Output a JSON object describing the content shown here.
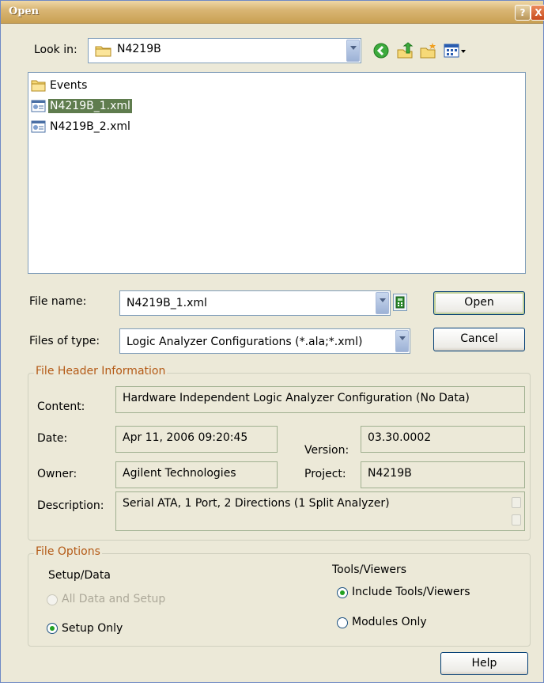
{
  "window": {
    "title": "Open",
    "help_glyph": "?",
    "close_glyph": "X"
  },
  "look_in": {
    "label": "Look in:",
    "value": "N4219B"
  },
  "toolbar": {
    "icons": [
      "back-icon",
      "up-folder-icon",
      "new-folder-icon",
      "views-menu-icon"
    ]
  },
  "files": [
    {
      "name": "Events",
      "type": "folder",
      "selected": false
    },
    {
      "name": "N4219B_1.xml",
      "type": "xml",
      "selected": true
    },
    {
      "name": "N4219B_2.xml",
      "type": "xml",
      "selected": false
    }
  ],
  "file_name": {
    "label": "File name:",
    "value": "N4219B_1.xml"
  },
  "files_of_type": {
    "label": "Files of type:",
    "value": "Logic Analyzer Configurations (*.ala;*.xml)"
  },
  "buttons": {
    "open": "Open",
    "cancel": "Cancel",
    "help": "Help"
  },
  "header_info": {
    "title": "File Header Information",
    "content_label": "Content:",
    "content_value": "Hardware Independent Logic Analyzer Configuration (No Data)",
    "date_label": "Date:",
    "date_value": "Apr 11, 2006 09:20:45",
    "version_label": "Version:",
    "version_value": "03.30.0002",
    "owner_label": "Owner:",
    "owner_value": "Agilent Technologies",
    "project_label": "Project:",
    "project_value": "N4219B",
    "description_label": "Description:",
    "description_value": "Serial ATA, 1 Port, 2 Directions (1 Split Analyzer)"
  },
  "file_options": {
    "title": "File Options",
    "setup_data_label": "Setup/Data",
    "all_data_setup": "All Data and Setup",
    "setup_only": "Setup Only",
    "tools_viewers_label": "Tools/Viewers",
    "include_tools": "Include Tools/Viewers",
    "modules_only": "Modules Only"
  }
}
